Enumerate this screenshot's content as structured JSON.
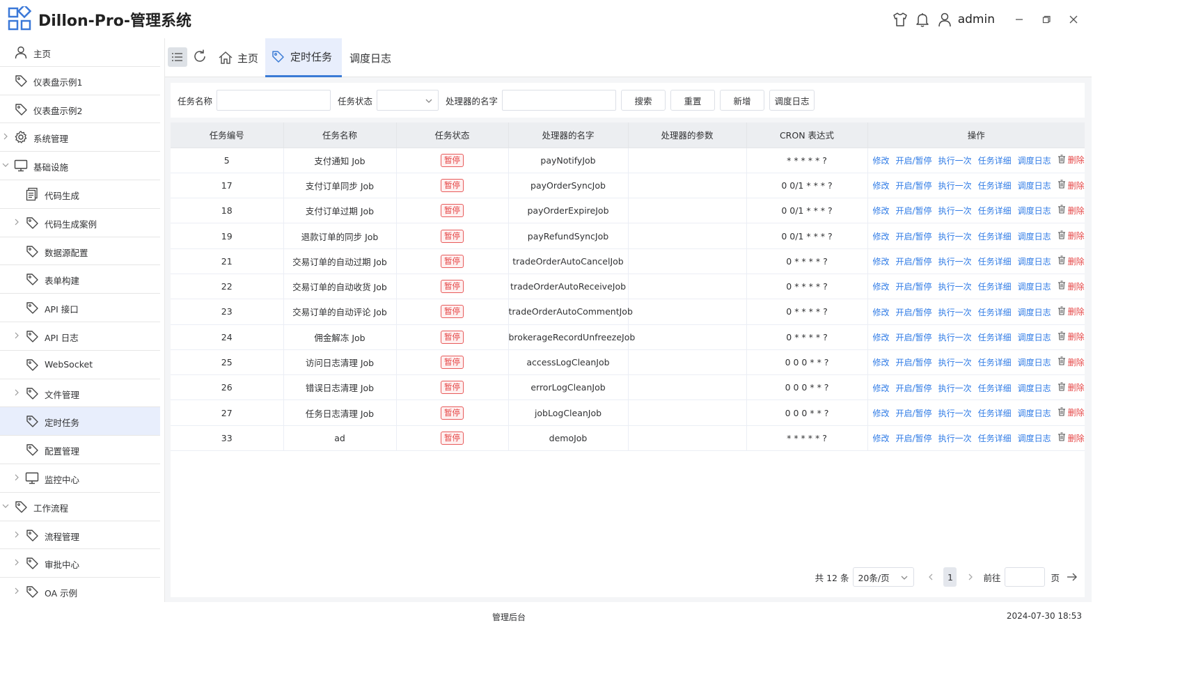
{
  "app": {
    "title": "Dillon-Pro-管理系统",
    "user": "admin"
  },
  "sidebar": {
    "items": [
      {
        "label": "主页",
        "icon": "user-icon",
        "level": 0,
        "expander": ""
      },
      {
        "label": "仪表盘示例1",
        "icon": "tag-icon",
        "level": 0,
        "expander": ""
      },
      {
        "label": "仪表盘示例2",
        "icon": "tag-icon",
        "level": 0,
        "expander": ""
      },
      {
        "label": "系统管理",
        "icon": "gear-icon",
        "level": 0,
        "expander": "collapsed"
      },
      {
        "label": "基础设施",
        "icon": "monitor-icon",
        "level": 0,
        "expander": "expanded"
      },
      {
        "label": "代码生成",
        "icon": "document-icon",
        "level": 1,
        "expander": ""
      },
      {
        "label": "代码生成案例",
        "icon": "tag-icon",
        "level": 1,
        "expander": "collapsed"
      },
      {
        "label": "数据源配置",
        "icon": "tag-icon",
        "level": 1,
        "expander": ""
      },
      {
        "label": "表单构建",
        "icon": "tag-icon",
        "level": 1,
        "expander": ""
      },
      {
        "label": "API 接口",
        "icon": "tag-icon",
        "level": 1,
        "expander": ""
      },
      {
        "label": "API 日志",
        "icon": "tag-icon",
        "level": 1,
        "expander": "collapsed"
      },
      {
        "label": "WebSocket",
        "icon": "tag-icon",
        "level": 1,
        "expander": ""
      },
      {
        "label": "文件管理",
        "icon": "tag-icon",
        "level": 1,
        "expander": "collapsed"
      },
      {
        "label": "定时任务",
        "icon": "tag-icon",
        "level": 1,
        "expander": "",
        "active": true
      },
      {
        "label": "配置管理",
        "icon": "tag-icon",
        "level": 1,
        "expander": ""
      },
      {
        "label": "监控中心",
        "icon": "monitor-icon",
        "level": 1,
        "expander": "collapsed"
      },
      {
        "label": "工作流程",
        "icon": "tag-icon",
        "level": 0,
        "expander": "expanded"
      },
      {
        "label": "流程管理",
        "icon": "tag-icon",
        "level": 1,
        "expander": "collapsed"
      },
      {
        "label": "审批中心",
        "icon": "tag-icon",
        "level": 1,
        "expander": "collapsed"
      },
      {
        "label": "OA 示例",
        "icon": "tag-icon",
        "level": 1,
        "expander": "collapsed"
      }
    ]
  },
  "tabs": [
    {
      "label": "主页",
      "icon": "home-icon"
    },
    {
      "label": "定时任务",
      "icon": "tag-icon",
      "active": true
    },
    {
      "label": "调度日志"
    }
  ],
  "search": {
    "name_label": "任务名称",
    "name_value": "",
    "status_label": "任务状态",
    "status_value": "",
    "handler_label": "处理器的名字",
    "handler_value": "",
    "btn_search": "搜索",
    "btn_reset": "重置",
    "btn_add": "新增",
    "btn_log": "调度日志"
  },
  "table": {
    "columns": [
      "任务编号",
      "任务名称",
      "任务状态",
      "处理器的名字",
      "处理器的参数",
      "CRON 表达式",
      "操作"
    ],
    "actions": [
      "修改",
      "开启/暂停",
      "执行一次",
      "任务详细",
      "调度日志"
    ],
    "delete_label": "删除",
    "rows": [
      {
        "id": "5",
        "name": "支付通知 Job",
        "status": "暂停",
        "handler": "payNotifyJob",
        "params": "",
        "cron": "* * * * * ?"
      },
      {
        "id": "17",
        "name": "支付订单同步 Job",
        "status": "暂停",
        "handler": "payOrderSyncJob",
        "params": "",
        "cron": "0 0/1 * * * ?"
      },
      {
        "id": "18",
        "name": "支付订单过期 Job",
        "status": "暂停",
        "handler": "payOrderExpireJob",
        "params": "",
        "cron": "0 0/1 * * * ?"
      },
      {
        "id": "19",
        "name": "退款订单的同步 Job",
        "status": "暂停",
        "handler": "payRefundSyncJob",
        "params": "",
        "cron": "0 0/1 * * * ?"
      },
      {
        "id": "21",
        "name": "交易订单的自动过期 Job",
        "status": "暂停",
        "handler": "tradeOrderAutoCancelJob",
        "params": "",
        "cron": "0 * * * * ?"
      },
      {
        "id": "22",
        "name": "交易订单的自动收货 Job",
        "status": "暂停",
        "handler": "tradeOrderAutoReceiveJob",
        "params": "",
        "cron": "0 * * * * ?"
      },
      {
        "id": "23",
        "name": "交易订单的自动评论 Job",
        "status": "暂停",
        "handler": "tradeOrderAutoCommentJob",
        "params": "",
        "cron": "0 * * * * ?"
      },
      {
        "id": "24",
        "name": "佣金解冻 Job",
        "status": "暂停",
        "handler": "brokerageRecordUnfreezeJob",
        "params": "",
        "cron": "0 * * * * ?"
      },
      {
        "id": "25",
        "name": "访问日志清理 Job",
        "status": "暂停",
        "handler": "accessLogCleanJob",
        "params": "",
        "cron": "0 0 0 * * ?"
      },
      {
        "id": "26",
        "name": "错误日志清理 Job",
        "status": "暂停",
        "handler": "errorLogCleanJob",
        "params": "",
        "cron": "0 0 0 * * ?"
      },
      {
        "id": "27",
        "name": "任务日志清理 Job",
        "status": "暂停",
        "handler": "jobLogCleanJob",
        "params": "",
        "cron": "0 0 0 * * ?"
      },
      {
        "id": "33",
        "name": "ad",
        "status": "暂停",
        "handler": "demoJob",
        "params": "",
        "cron": "* * * * * ?"
      }
    ]
  },
  "pagination": {
    "total": "共 12 条",
    "page_size": "20条/页",
    "current": "1",
    "goto_label": "前往",
    "page_suffix": "页",
    "goto_value": ""
  },
  "footer": {
    "center": "管理后台",
    "datetime": "2024-07-30 18:53"
  },
  "colors": {
    "accent": "#3a7bd5",
    "link": "#2f7be6",
    "danger": "#e54545",
    "active_bg": "#e8eefc"
  }
}
